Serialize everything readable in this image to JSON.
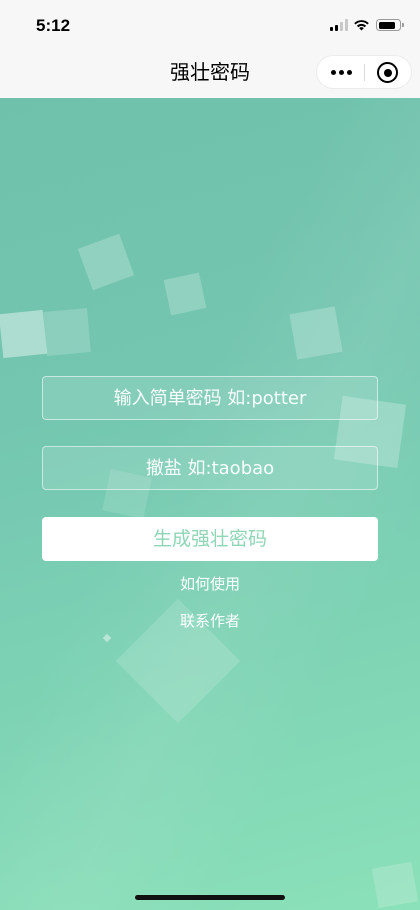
{
  "status_bar": {
    "time": "5:12",
    "icons": [
      "signal-icon",
      "wifi-icon",
      "battery-icon"
    ],
    "signal_level": 2,
    "signal_max": 4,
    "battery_level": 0.8
  },
  "nav": {
    "title": "强壮密码",
    "icons": [
      "more-icon",
      "target-icon"
    ]
  },
  "form": {
    "password_placeholder": "输入简单密码 如:potter",
    "salt_placeholder": "撤盐 如:taobao",
    "generate_label": "生成强壮密码"
  },
  "links": {
    "how_to_use": "如何使用",
    "contact_author": "联系作者"
  },
  "colors": {
    "header_bg": "#f7f7f7",
    "gradient_top": "#70c1ac",
    "gradient_bottom": "#8be1b9",
    "button_bg": "#ffffff",
    "button_text": "#8fd6b6",
    "text": "#ffffff"
  }
}
